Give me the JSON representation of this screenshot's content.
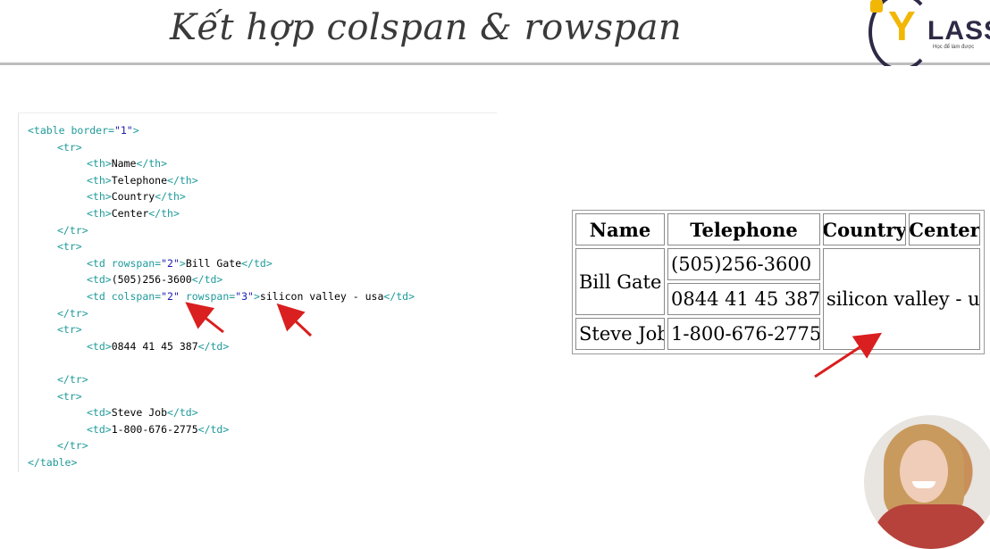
{
  "header": {
    "title": "Kết hợp colspan & rowspan"
  },
  "logo": {
    "letter": "Y",
    "word": "LASS",
    "tagline": "Học để làm được"
  },
  "code": {
    "lines": [
      {
        "indent": 0,
        "parts": [
          {
            "t": "tag",
            "v": "<table "
          },
          {
            "t": "attr",
            "v": "border="
          },
          {
            "t": "val",
            "v": "\"1\""
          },
          {
            "t": "tag",
            "v": ">"
          }
        ]
      },
      {
        "indent": 1,
        "parts": [
          {
            "t": "tag",
            "v": "<tr>"
          }
        ]
      },
      {
        "indent": 2,
        "parts": [
          {
            "t": "tag",
            "v": "<th>"
          },
          {
            "t": "txt",
            "v": "Name"
          },
          {
            "t": "tag",
            "v": "</th>"
          }
        ]
      },
      {
        "indent": 2,
        "parts": [
          {
            "t": "tag",
            "v": "<th>"
          },
          {
            "t": "txt",
            "v": "Telephone"
          },
          {
            "t": "tag",
            "v": "</th>"
          }
        ]
      },
      {
        "indent": 2,
        "parts": [
          {
            "t": "tag",
            "v": "<th>"
          },
          {
            "t": "txt",
            "v": "Country"
          },
          {
            "t": "tag",
            "v": "</th>"
          }
        ]
      },
      {
        "indent": 2,
        "parts": [
          {
            "t": "tag",
            "v": "<th>"
          },
          {
            "t": "txt",
            "v": "Center"
          },
          {
            "t": "tag",
            "v": "</th>"
          }
        ]
      },
      {
        "indent": 1,
        "parts": [
          {
            "t": "tag",
            "v": "</tr>"
          }
        ]
      },
      {
        "indent": 1,
        "parts": [
          {
            "t": "tag",
            "v": "<tr>"
          }
        ]
      },
      {
        "indent": 2,
        "parts": [
          {
            "t": "tag",
            "v": "<td "
          },
          {
            "t": "attr",
            "v": "rowspan="
          },
          {
            "t": "val",
            "v": "\"2\""
          },
          {
            "t": "tag",
            "v": ">"
          },
          {
            "t": "txt",
            "v": "Bill Gate"
          },
          {
            "t": "tag",
            "v": "</td>"
          }
        ]
      },
      {
        "indent": 2,
        "parts": [
          {
            "t": "tag",
            "v": "<td>"
          },
          {
            "t": "txt",
            "v": "(505)256-3600"
          },
          {
            "t": "tag",
            "v": "</td>"
          }
        ]
      },
      {
        "indent": 2,
        "parts": [
          {
            "t": "tag",
            "v": "<td "
          },
          {
            "t": "attr",
            "v": "colspan="
          },
          {
            "t": "val",
            "v": "\"2\""
          },
          {
            "t": "txt",
            "v": " "
          },
          {
            "t": "attr",
            "v": "rowspan="
          },
          {
            "t": "val",
            "v": "\"3\""
          },
          {
            "t": "tag",
            "v": ">"
          },
          {
            "t": "txt",
            "v": "silicon valley - usa"
          },
          {
            "t": "tag",
            "v": "</td>"
          }
        ]
      },
      {
        "indent": 1,
        "parts": [
          {
            "t": "tag",
            "v": "</tr>"
          }
        ]
      },
      {
        "indent": 1,
        "parts": [
          {
            "t": "tag",
            "v": "<tr>"
          }
        ]
      },
      {
        "indent": 2,
        "parts": [
          {
            "t": "tag",
            "v": "<td>"
          },
          {
            "t": "txt",
            "v": "0844 41 45 387"
          },
          {
            "t": "tag",
            "v": "</td>"
          }
        ]
      },
      {
        "indent": 0,
        "parts": []
      },
      {
        "indent": 1,
        "parts": [
          {
            "t": "tag",
            "v": "</tr>"
          }
        ]
      },
      {
        "indent": 1,
        "parts": [
          {
            "t": "tag",
            "v": "<tr>"
          }
        ]
      },
      {
        "indent": 2,
        "parts": [
          {
            "t": "tag",
            "v": "<td>"
          },
          {
            "t": "txt",
            "v": "Steve Job"
          },
          {
            "t": "tag",
            "v": "</td>"
          }
        ]
      },
      {
        "indent": 2,
        "parts": [
          {
            "t": "tag",
            "v": "<td>"
          },
          {
            "t": "txt",
            "v": "1-800-676-2775"
          },
          {
            "t": "tag",
            "v": "</td>"
          }
        ]
      },
      {
        "indent": 1,
        "parts": [
          {
            "t": "tag",
            "v": "</tr>"
          }
        ]
      },
      {
        "indent": 0,
        "parts": [
          {
            "t": "tag",
            "v": "</table>"
          }
        ]
      }
    ]
  },
  "rendered_table": {
    "headers": [
      "Name",
      "Telephone",
      "Country",
      "Center"
    ],
    "bill_gate": "Bill Gate",
    "phone_1": "(505)256-3600",
    "phone_2": "0844 41 45 387",
    "silicon": "silicon valley - usa",
    "steve_job": "Steve Job",
    "phone_3": "1-800-676-2775"
  },
  "colors": {
    "arrow": "#d91f1f",
    "code_tag": "#1f9a9a",
    "code_value": "#1a1ab0"
  }
}
